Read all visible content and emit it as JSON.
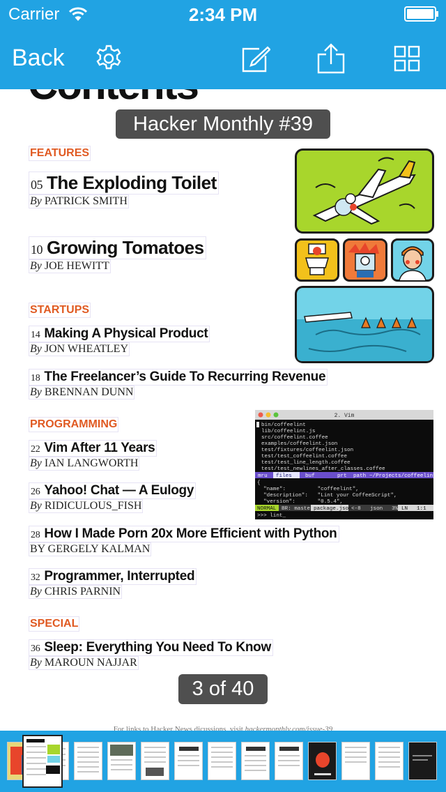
{
  "status_bar": {
    "carrier": "Carrier",
    "time": "2:34 PM"
  },
  "nav": {
    "back_label": "Back",
    "icons": [
      "gear-icon",
      "compose-icon",
      "share-icon",
      "grid-icon"
    ]
  },
  "overlay": {
    "issue_title": "Hacker Monthly #39",
    "page_counter": "3 of 40"
  },
  "page": {
    "heading": "Contents",
    "sections": [
      {
        "label": "FEATURES",
        "articles": [
          {
            "page": "05",
            "title": "The Exploding Toilet",
            "by": "By",
            "author": "PATRICK SMITH"
          },
          {
            "page": "10",
            "title": "Growing Tomatoes",
            "by": "By",
            "author": "JOE HEWITT"
          }
        ]
      },
      {
        "label": "STARTUPS",
        "articles": [
          {
            "page": "14",
            "title": "Making A Physical Product",
            "by": "By",
            "author": "JON WHEATLEY"
          },
          {
            "page": "18",
            "title": "The Freelancer’s Guide To Recurring Revenue",
            "by": "By",
            "author": "BRENNAN DUNN"
          }
        ]
      },
      {
        "label": "PROGRAMMING",
        "articles": [
          {
            "page": "22",
            "title": "Vim After 11 Years",
            "by": "By",
            "author": "IAN LANGWORTH"
          },
          {
            "page": "26",
            "title": "Yahoo! Chat — A Eulogy",
            "by": "By",
            "author": "RIDICULOUS_FISH"
          },
          {
            "page": "28",
            "title": "How I Made Porn 20x More Efficient with Python",
            "by": "BY",
            "author": "GERGELY KALMAN"
          },
          {
            "page": "32",
            "title": "Programmer, Interrupted",
            "by": "By",
            "author": "CHRIS PARNIN"
          }
        ]
      },
      {
        "label": "SPECIAL",
        "articles": [
          {
            "page": "36",
            "title": "Sleep: Everything You Need To Know",
            "by": "By",
            "author": "MAROUN NAJJAR"
          }
        ]
      }
    ],
    "footer_prefix": "For links to Hacker News dicussions, visit",
    "footer_link": "hackermonthly.com/issue-39"
  },
  "vim_window": {
    "title": "2. Vim",
    "files": [
      "bin/coffeelint",
      "lib/coffeelint.js",
      "src/coffeelint.coffee",
      "examples/coffeelint.json",
      "test/fixtures/coffeelint.json",
      "test/test_coffeelint.coffee",
      "test/test_line_length.coffee",
      "test/test_newlines_after_classes.coffee"
    ],
    "tab_line": {
      "mru": "mru",
      "files": "files",
      "buf": "buf",
      "prt": "prt",
      "path": "path",
      "cwd": "~/Projects/coffeelint"
    },
    "json_lines": [
      "{",
      "  \"name\":          \"coffeelint\",",
      "  \"description\":   \"Lint your CoffeeScript\",",
      "  \"version\":       \"0.5.4\","
    ],
    "status_line": {
      "mode": "NORMAL",
      "branch": "BR: master",
      "file": "package.json",
      "enc": "<-8",
      "type": "json",
      "pct": "3%",
      "ln": "LN",
      "pos": "1:1"
    },
    "cmd": ">>> lint_"
  },
  "colors": {
    "accent": "#21a3e3",
    "section": "#e05a22",
    "lime": "#a8d62c",
    "sky": "#72d3e8"
  }
}
